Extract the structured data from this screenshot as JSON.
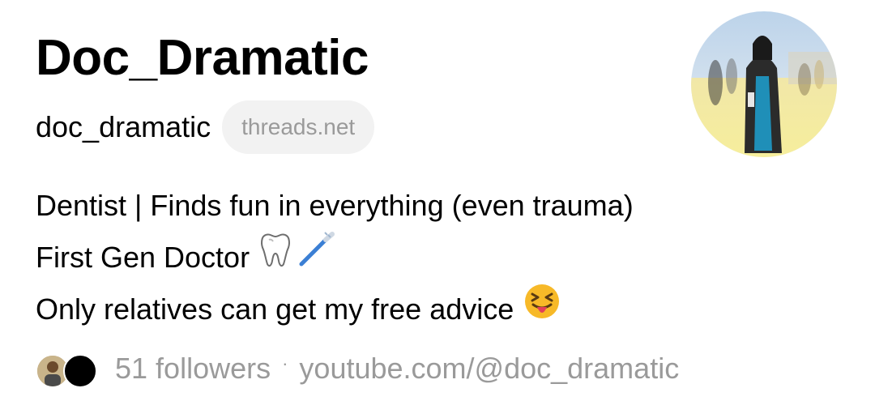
{
  "profile": {
    "display_name": "Doc_Dramatic",
    "username": "doc_dramatic",
    "domain_badge": "threads.net"
  },
  "bio": {
    "line1": "Dentist | Finds fun in everything (even trauma)",
    "line2": "First Gen Doctor",
    "line3": "Only relatives can get my free advice"
  },
  "meta": {
    "followers_label": "51 followers",
    "separator": "·",
    "link": "youtube.com/@doc_dramatic"
  },
  "icons": {
    "tooth": "tooth-icon",
    "toothbrush": "toothbrush-icon",
    "tongue_emoji": "squinting-face-with-tongue-icon"
  },
  "colors": {
    "text": "#000000",
    "muted": "#9a9a9a",
    "pill_bg": "#f2f2f2"
  }
}
